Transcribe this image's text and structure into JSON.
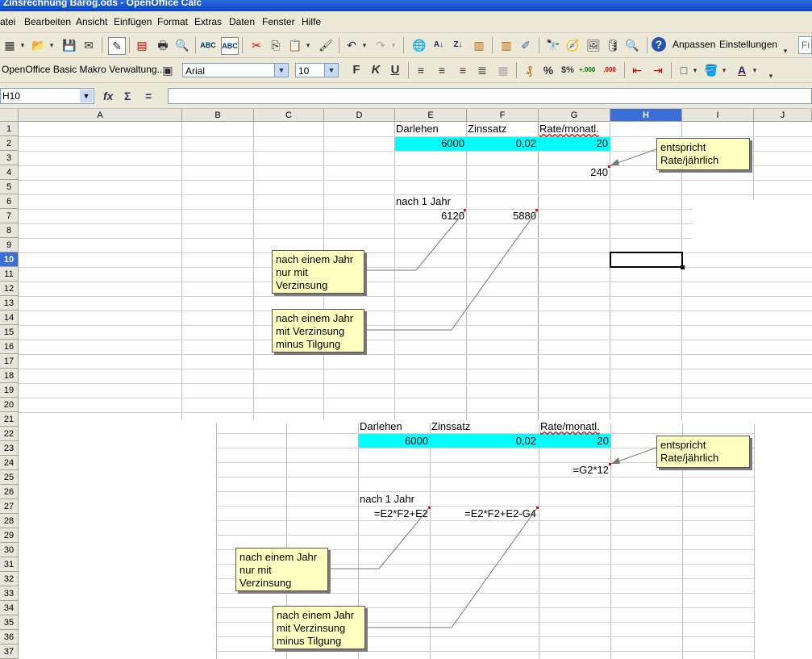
{
  "window": {
    "title": "Zinsrechnung Barog.ods - OpenOffice Calc"
  },
  "menu": [
    "atei",
    "Bearbeiten",
    "Ansicht",
    "Einfügen",
    "Format",
    "Extras",
    "Daten",
    "Fenster",
    "Hilfe"
  ],
  "toolbar": {
    "anpassen_label": "Anpassen",
    "einstellungen_label": "Einstellungen",
    "search_placeholder": "Fi",
    "macro_label": "OpenOffice Basic Makro Verwaltung...",
    "font_name": "Arial",
    "font_size": "10",
    "bold_label": "F",
    "italic_label": "K",
    "underline_label": "U",
    "percent_label": "%",
    "currency_label": "$%",
    "decimal_add_label": "+.000",
    "decimal_del_label": ".000"
  },
  "formula_bar": {
    "cell_ref": "H10",
    "content": ""
  },
  "columns": [
    "A",
    "B",
    "C",
    "D",
    "E",
    "F",
    "G",
    "H",
    "I",
    "J"
  ],
  "selected_column": "H",
  "rows": [
    "1",
    "2",
    "3",
    "4",
    "5",
    "6",
    "7",
    "8",
    "9",
    "10",
    "11",
    "12",
    "13",
    "14",
    "15",
    "16",
    "17",
    "18",
    "19",
    "20",
    "21",
    "22",
    "23",
    "24",
    "25",
    "26",
    "27",
    "28",
    "29",
    "30",
    "31",
    "32",
    "33",
    "34",
    "35",
    "36",
    "37"
  ],
  "selected_row": "10",
  "top_table": {
    "h_darlehen": "Darlehen",
    "h_zinssatz": "Zinssatz",
    "h_rate": "Rate/monatl.",
    "v_darlehen": "6000",
    "v_zinssatz": "0,02",
    "v_rate": "20",
    "v_rate_year": "240",
    "label_after": "nach 1 Jahr",
    "v_after_interest": "6120",
    "v_after_total": "5880"
  },
  "bottom_table": {
    "h_darlehen": "Darlehen",
    "h_zinssatz": "Zinssatz",
    "h_rate": "Rate/monatl.",
    "v_darlehen": "6000",
    "v_zinssatz": "0,02",
    "v_rate": "20",
    "f_rate_year": "=G2*12",
    "label_after": "nach 1 Jahr",
    "f_after_interest": "=E2*F2+E2",
    "f_after_total": "=E2*F2+E2-G4"
  },
  "notes": {
    "rate_year": [
      "entspricht",
      "Rate/jährlich"
    ],
    "interest_only": [
      "nach einem Jahr",
      "nur mit",
      "Verzinsung"
    ],
    "interest_minus": [
      "nach einem Jahr",
      "mit Verzinsung",
      "minus Tilgung"
    ]
  }
}
